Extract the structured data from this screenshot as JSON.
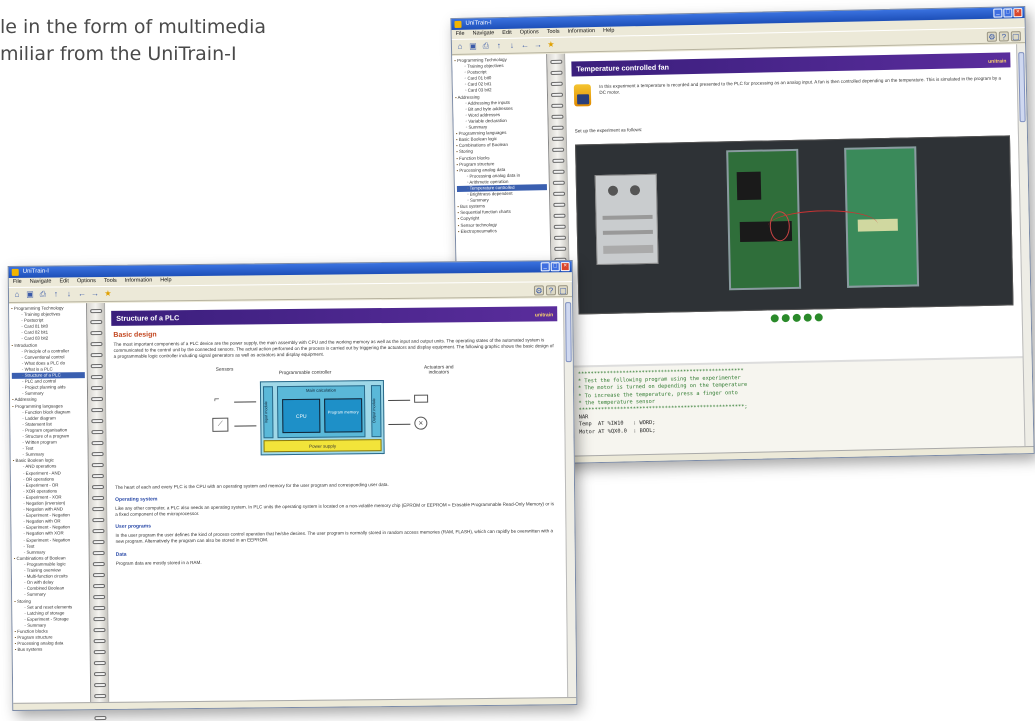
{
  "caption": {
    "line1": "le in the form of multimedia",
    "line2": "miliar from the UniTrain-I"
  },
  "menu": [
    "File",
    "Navigate",
    "Edit",
    "Options",
    "Tools",
    "Information",
    "Help"
  ],
  "brand": "unitrain",
  "back_window": {
    "title": "Temperature controlled fan",
    "intro": "In this experiment a temperature is recorded and presented to the PLC for processing as an analog input. A fan is then controlled depending on the temperature. This is simulated in the program by a DC motor.",
    "setup_text": "Set up the experiment as follows:",
    "code_lines": [
      "****************************************************",
      "* Test the following program using the experimenter",
      "* The motor is turned on depending on the temperature",
      "* To increase the temperature, press a finger onto",
      "* the temperature sensor",
      "****************************************************;",
      "NAR",
      "Temp  AT %IW10   : WORD;",
      "Motor AT %QX0.0  : BOOL;"
    ],
    "tree": [
      "Programming Technology",
      "Training objectives",
      "Postscript",
      "Card 01 bit0",
      "Card 02 bit1",
      "Card 03 bit2",
      "Addressing",
      "Addressing the inputs",
      "Bit and byte addresses",
      "Word addresses",
      "Variable declaration",
      "Summary",
      "Programming languages",
      "Basic Boolean logic",
      "Combinations of Boolean",
      "Storing",
      "Function blocks",
      "Program structure",
      "Processing analog data",
      "Processing analog data in",
      "Arithmetic operation",
      "Temperature controlled",
      "Brightness dependent",
      "Summary",
      "Bus systems",
      "Sequential function charts",
      "Copyright",
      "Sensor technology",
      "Electropneumatics"
    ]
  },
  "front_window": {
    "title": "Structure of a PLC",
    "subtitle": "Basic design",
    "intro": "The most important components of a PLC device are the power supply, the main assembly with CPU and the working memory as well as the input and output units. The operating states of the automated system is communicated to the control unit by the connected sensors. The actual action performed on the process is carried out by triggering the actuators and display equipment. The following graphic shows the basic design of a programmable logic controller including signal generators as well as actuators and display equipment.",
    "diagram": {
      "sensors": "Sensors",
      "controller": "Programmable controller",
      "actuators": "Actuators and indicators",
      "main_calc": "Main calculation",
      "cpu": "CPU",
      "memory": "Program memory",
      "input_module": "Input module",
      "output_module": "Output module",
      "power": "Power supply"
    },
    "para_plc": "The heart of each and every PLC is the CPU with an operating system and memory for the user program and corresponding user data.",
    "h_os": "Operating system",
    "para_os": "Like any other computer, a PLC also needs an operating system. In PLC units the operating system is located on a non-volatile memory chip (EPROM or EEPROM = Erasable Programmable Read-Only Memory) or is a fixed component of the microprocessor.",
    "h_user": "User programs",
    "para_user": "In the user program the user defines the kind of process control operation that he/she desires. The user program is normally stored in random access memories (RAM, FLASH), which can rapidly be overwritten with a new program. Alternatively the program can also be stored in an EEPROM.",
    "h_data": "Data",
    "para_data": "Program data are mostly stored in a RAM.",
    "tree": [
      "Programming Technology",
      "Training objectives",
      "Postscript",
      "Card 01 bit0",
      "Card 02 bit1",
      "Card 03 bit2",
      "Introduction",
      "Principle of a controller",
      "Conventional control",
      "What does a PLC do",
      "What is a PLC",
      "Structure of a PLC",
      "PLC and control",
      "Project planning aids",
      "Summary",
      "Addressing",
      "Programming languages",
      "Function block diagram",
      "Ladder diagram",
      "Statement list",
      "Program organisation",
      "Structure of a program",
      "Written program",
      "Test",
      "Summary",
      "Basic Boolean logic",
      "AND operations",
      "Experiment - AND",
      "OR operations",
      "Experiment - OR",
      "XOR operations",
      "Experiment - XOR",
      "Negation (inversion)",
      "Negation with AND",
      "Experiment - Negation",
      "Negation with OR",
      "Experiment - Negation",
      "Negation with XOR",
      "Experiment - Negation",
      "Test",
      "Summary",
      "Combinations of Boolean",
      "Programmable logic",
      "Training overview",
      "Multi-function circuits",
      "On with delay",
      "Combined Boolean",
      "Summary",
      "Storing",
      "Set and reset elements",
      "Latching of storage",
      "Experiment - Storage",
      "Summary",
      "Function blocks",
      "Program structure",
      "Processing analog data",
      "Bus systems"
    ]
  }
}
